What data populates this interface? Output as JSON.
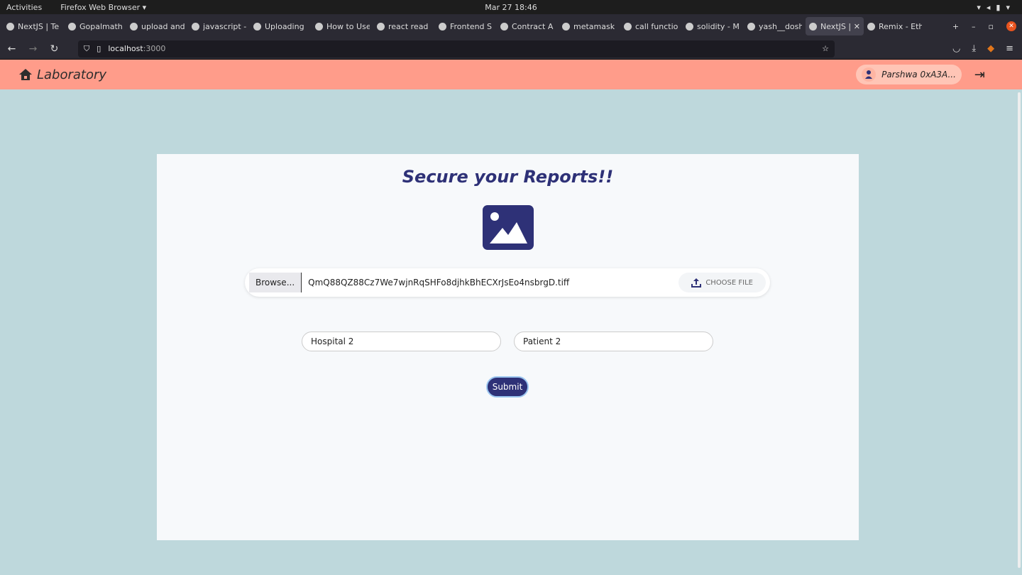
{
  "system": {
    "activities": "Activities",
    "app": "Firefox Web Browser ▾",
    "clock": "Mar 27  18:46"
  },
  "tabs": [
    {
      "label": "NextJS | Te"
    },
    {
      "label": "Gopalmath"
    },
    {
      "label": "upload and"
    },
    {
      "label": "javascript -"
    },
    {
      "label": "Uploading"
    },
    {
      "label": "How to Use"
    },
    {
      "label": "react read"
    },
    {
      "label": "Frontend S"
    },
    {
      "label": "Contract A"
    },
    {
      "label": "metamask"
    },
    {
      "label": "call functio"
    },
    {
      "label": "solidity - M"
    },
    {
      "label": "yash__dosh"
    },
    {
      "label": "NextJS |",
      "active": true
    },
    {
      "label": "Remix - Eth"
    }
  ],
  "browser": {
    "url_host": "localhost",
    "url_port": ":3000"
  },
  "header": {
    "brand": "Laboratory",
    "user": "Parshwa 0xA3A..."
  },
  "form": {
    "title": "Secure your Reports!!",
    "browse_label": "Browse...",
    "file_name": "QmQ88QZ88Cz7We7wjnRqSHFo8djhkBhECXrJsEo4nsbrgD.tiff",
    "choose_label": "CHOOSE FILE",
    "hospital_value": "Hospital 2",
    "patient_value": "Patient 2",
    "submit_label": "Submit"
  },
  "colors": {
    "header": "#ff9c8a",
    "accent": "#2e3177",
    "background": "#bed8dc"
  }
}
